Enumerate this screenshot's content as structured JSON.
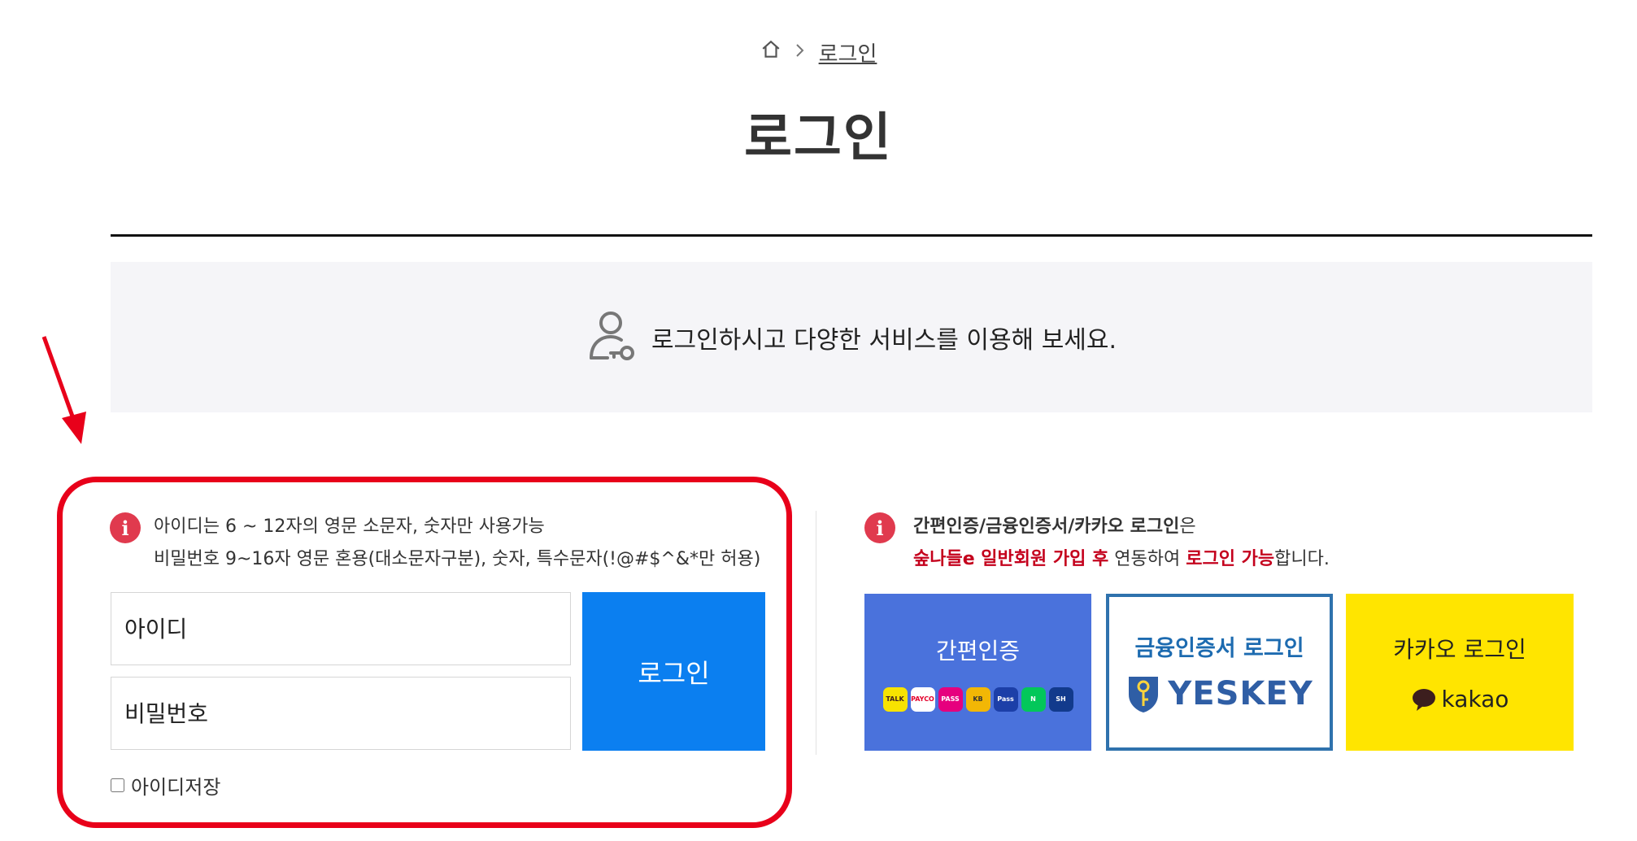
{
  "breadcrumb": {
    "home_icon": "home-icon",
    "separator_icon": "chevron-right-icon",
    "current": "로그인"
  },
  "page_title": "로그인",
  "banner": {
    "icon": "user-key-icon",
    "text": "로그인하시고 다양한 서비스를 이용해 보세요."
  },
  "left_panel": {
    "info_icon": "info-icon",
    "info_line1": "아이디는 6 ~ 12자의 영문 소문자, 숫자만 사용가능",
    "info_line2": "비밀번호 9~16자 영문 혼용(대소문자구분), 숫자, 특수문자(!@#$^&*만 허용)",
    "id_placeholder": "아이디",
    "pw_placeholder": "비밀번호",
    "login_button": "로그인",
    "save_id_label": "아이디저장"
  },
  "right_panel": {
    "info_icon": "info-icon",
    "line1_strong": "간편인증/금융인증서/카카오 로그인",
    "line1_rest": "은",
    "line2_red1": "숲나들e 일반회원 가입 후",
    "line2_mid": " 연동하여 ",
    "line2_red2": "로그인 가능",
    "line2_end": "합니다."
  },
  "options": {
    "simple_auth": {
      "label": "간편인증",
      "apps": [
        {
          "name": "kakaotalk-icon",
          "text": "TALK",
          "color": "#f7e300",
          "fg": "#3c1e1e"
        },
        {
          "name": "payco-icon",
          "text": "PAYCO",
          "color": "#ffffff",
          "fg": "#e4002b"
        },
        {
          "name": "pass-icon",
          "text": "PASS",
          "color": "#e6007e",
          "fg": "#ffffff"
        },
        {
          "name": "kb-icon",
          "text": "KB",
          "color": "#f2b705",
          "fg": "#333333"
        },
        {
          "name": "samsung-pass-icon",
          "text": "Pass",
          "color": "#1c3fa8",
          "fg": "#ffffff"
        },
        {
          "name": "naver-icon",
          "text": "N",
          "color": "#03c75a",
          "fg": "#ffffff"
        },
        {
          "name": "shinhan-icon",
          "text": "SH",
          "color": "#123a8c",
          "fg": "#ffffff"
        }
      ]
    },
    "financial_cert": {
      "label": "금융인증서 로그인",
      "brand": "YESKEY",
      "brand_icon": "yeskey-shield-icon"
    },
    "kakao": {
      "label": "카카오 로그인",
      "brand": "kakao",
      "brand_icon": "kakao-speech-bubble-icon"
    }
  },
  "colors": {
    "annotation": "#e8001a",
    "login_button": "#0b7ff0",
    "simple_auth_bg": "#4a72dc",
    "cert_border": "#2f72ad",
    "kakao_bg": "#ffe500",
    "info_badge": "#e03a4e",
    "highlight_red": "#c4001c"
  }
}
